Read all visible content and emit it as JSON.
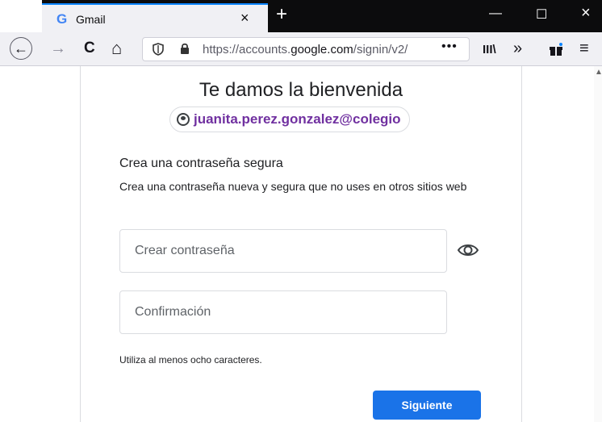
{
  "browser": {
    "tab": {
      "favicon": "G",
      "title": "Gmail",
      "close": "×"
    },
    "new_tab": "+",
    "window": {
      "minimize": "—",
      "maximize": "☐",
      "close": "×"
    },
    "nav": {
      "back": "←",
      "forward": "→",
      "reload": "C",
      "home": "⌂"
    },
    "url": {
      "prefix": "https://accounts.",
      "domain": "google.com",
      "suffix": "/signin/v2/",
      "more": "•••"
    },
    "toolbar": {
      "library": "III\\",
      "overflow": "»",
      "menu": "≡"
    }
  },
  "signin": {
    "heading": "Te damos la bienvenida",
    "account_email": "juanita.perez.gonzalez@colegio",
    "section_title": "Crea una contraseña segura",
    "section_description": "Crea una contraseña nueva y segura que no uses en otros sitios web",
    "password_placeholder": "Crear contraseña",
    "confirm_placeholder": "Confirmación",
    "hint": "Utiliza al menos ocho caracteres.",
    "next_button": "Siguiente"
  },
  "colors": {
    "accent": "#1a73e8",
    "email": "#7030a0",
    "tabbar": "#0c0c0d"
  },
  "icons": [
    "google-favicon-icon",
    "shield-icon",
    "lock-icon",
    "account-circle-icon",
    "eye-icon",
    "gift-icon",
    "library-icon",
    "hamburger-menu-icon"
  ]
}
